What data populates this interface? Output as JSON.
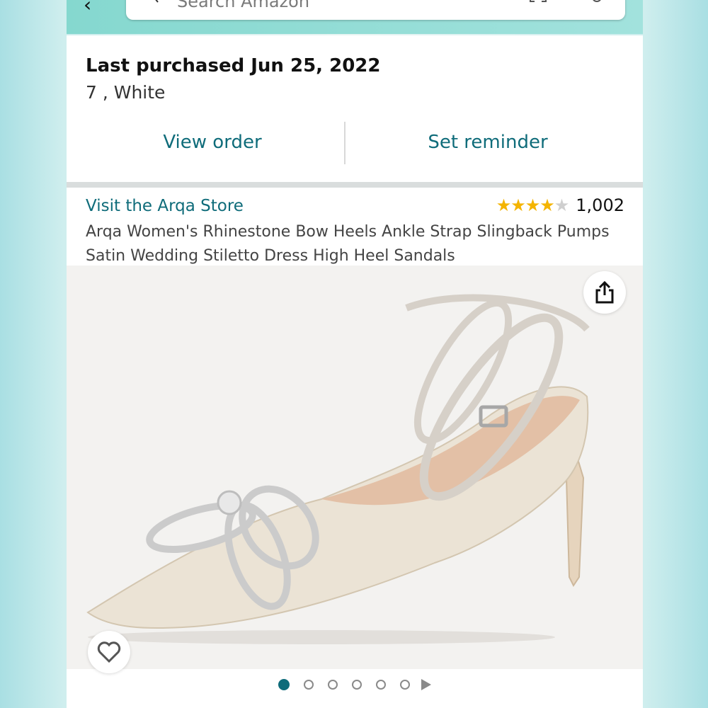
{
  "search": {
    "placeholder": "Search Amazon"
  },
  "purchase": {
    "last_purchased": "Last purchased Jun 25, 2022",
    "variant": "7 , White",
    "view_order_label": "View order",
    "set_reminder_label": "Set reminder"
  },
  "product": {
    "store_link": "Visit the Arqa Store",
    "rating": 4.0,
    "rating_count": "1,002",
    "title": "Arqa Women's Rhinestone Bow Heels Ankle Strap Slingback Pumps Satin Wedding Stiletto Dress High Heel Sandals",
    "image_count": 6,
    "active_image": 1
  },
  "colors": {
    "accent": "#0f6c7a",
    "star": "#f4b400",
    "header": "#85d8cf"
  },
  "icons": [
    "back-arrow-icon",
    "search-icon",
    "camera-scan-icon",
    "mic-icon",
    "share-icon",
    "heart-icon",
    "play-icon"
  ]
}
